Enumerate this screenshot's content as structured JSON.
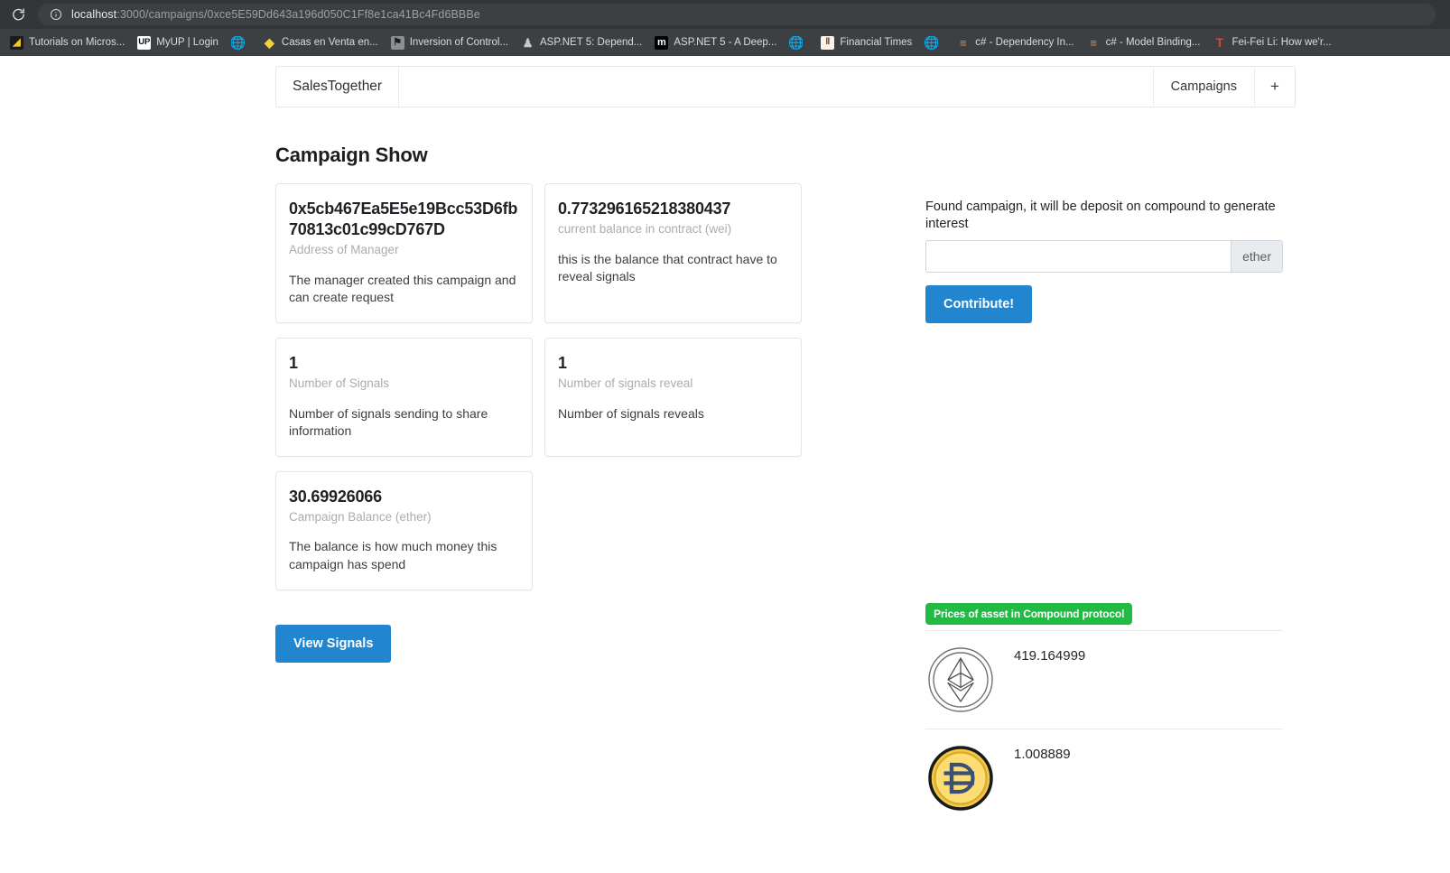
{
  "browser": {
    "reload_icon": "reload-icon",
    "security_icon": "info-circle-icon",
    "url_host": "localhost",
    "url_path": ":3000/campaigns/0xce5E59Dd643a196d050C1Ff8e1ca41Bc4Fd6BBBe",
    "bookmarks": [
      {
        "label": "Tutorials on Micros...",
        "icon": "microsoft-tutorials-icon",
        "icon_class": "fav-msft",
        "glyph": "◢"
      },
      {
        "label": "MyUP | Login",
        "icon": "myup-icon",
        "icon_class": "fav-up",
        "glyph": "UP"
      },
      {
        "label": "",
        "icon": "globe-icon",
        "icon_class": "fav-globe",
        "glyph": "🌐"
      },
      {
        "label": "Casas en Venta en...",
        "icon": "casas-icon",
        "icon_class": "fav-casas",
        "glyph": "◆"
      },
      {
        "label": "Inversion of Control...",
        "icon": "inversion-of-control-icon",
        "icon_class": "fav-ioc",
        "glyph": "⚑"
      },
      {
        "label": "ASP.NET 5: Depend...",
        "icon": "author-avatar-icon",
        "icon_class": "fav-person",
        "glyph": "♟"
      },
      {
        "label": "ASP.NET 5 - A Deep...",
        "icon": "medium-icon",
        "icon_class": "fav-m",
        "glyph": "m"
      },
      {
        "label": "",
        "icon": "globe-icon",
        "icon_class": "fav-globe",
        "glyph": "🌐"
      },
      {
        "label": "Financial Times",
        "icon": "financial-times-icon",
        "icon_class": "fav-ft",
        "glyph": "‖"
      },
      {
        "label": "",
        "icon": "globe-icon",
        "icon_class": "fav-globe",
        "glyph": "🌐"
      },
      {
        "label": "c# - Dependency In...",
        "icon": "stackoverflow-icon",
        "icon_class": "fav-cs",
        "glyph": "≡"
      },
      {
        "label": "c# - Model Binding...",
        "icon": "stackoverflow-icon",
        "icon_class": "fav-cs",
        "glyph": "≡"
      },
      {
        "label": "Fei-Fei Li: How we'r...",
        "icon": "ted-icon",
        "icon_class": "fav-t",
        "glyph": "T"
      }
    ]
  },
  "navbar": {
    "brand": "SalesTogether",
    "campaigns_label": "Campaigns",
    "add_label": "+"
  },
  "page": {
    "title": "Campaign Show"
  },
  "cards": [
    {
      "value": "0x5cb467Ea5E5e19Bcc53D6fb70813c01c99cD767D",
      "meta": "Address of Manager",
      "desc": "The manager created this campaign and can create request"
    },
    {
      "value": "0.773296165218380437",
      "meta": "current balance in contract (wei)",
      "desc": "this is the balance that contract have to reveal signals"
    },
    {
      "value": "1",
      "meta": "Number of Signals",
      "desc": "Number of signals sending to share information"
    },
    {
      "value": "1",
      "meta": "Number of signals reveal",
      "desc": "Number of signals reveals"
    },
    {
      "value": "30.69926066",
      "meta": "Campaign Balance (ether)",
      "desc": "The balance is how much money this campaign has spend"
    }
  ],
  "actions": {
    "view_signals": "View Signals",
    "contribute": "Contribute!"
  },
  "contribute_form": {
    "label": "Found campaign, it will be deposit on compound to generate interest",
    "amount_value": "",
    "amount_placeholder": "",
    "unit": "ether"
  },
  "prices": {
    "badge": "Prices of asset in Compound protocol",
    "items": [
      {
        "asset": "ethereum",
        "icon": "ethereum-coin-icon",
        "value": "419.164999"
      },
      {
        "asset": "dai",
        "icon": "dai-coin-icon",
        "value": "1.008889"
      }
    ]
  },
  "colors": {
    "accent_blue": "#2185d0",
    "badge_green": "#21ba45",
    "chrome_dark": "#323639",
    "bookmark_bar": "#3c4043"
  }
}
